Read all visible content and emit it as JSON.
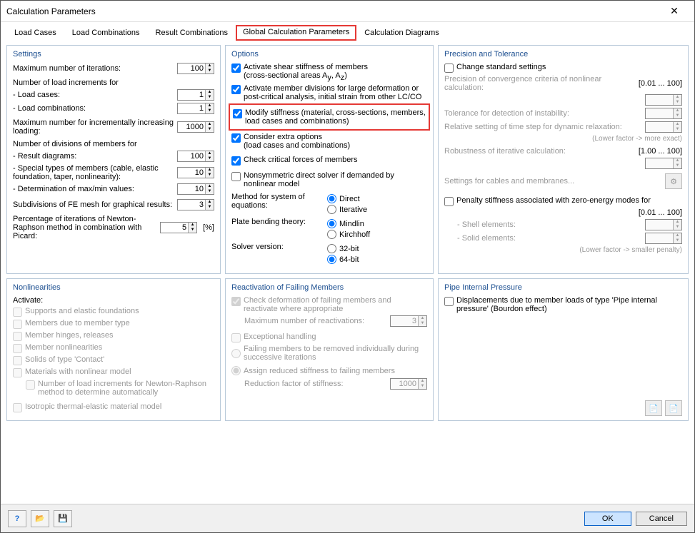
{
  "window": {
    "title": "Calculation Parameters"
  },
  "tabs": {
    "load_cases": "Load Cases",
    "load_comb": "Load Combinations",
    "result_comb": "Result Combinations",
    "global": "Global Calculation Parameters",
    "diagrams": "Calculation Diagrams"
  },
  "settings": {
    "title": "Settings",
    "max_iter_lbl": "Maximum number of iterations:",
    "max_iter": "100",
    "incr_hdr": "Number of load increments for",
    "lc_lbl": "- Load cases:",
    "lc": "1",
    "lco_lbl": "- Load combinations:",
    "lco": "1",
    "max_incr_lbl": "Maximum number for incrementally increasing loading:",
    "max_incr": "1000",
    "div_hdr": "Number of divisions of members for",
    "res_lbl": "- Result diagrams:",
    "res": "100",
    "spec_lbl": "- Special types of members (cable, elastic foundation, taper, nonlinearity):",
    "spec": "10",
    "det_lbl": "- Determination of max/min values:",
    "det": "10",
    "sub_lbl": "Subdivisions of FE mesh for graphical results:",
    "sub": "3",
    "nr_lbl": "Percentage of iterations of Newton-Raphson method in combination with Picard:",
    "nr": "5",
    "pct": "[%]"
  },
  "options": {
    "title": "Options",
    "shear": "Activate shear stiffness of members",
    "shear_sub": "(cross-sectional areas A",
    "shear_sub2": ", A",
    "shear_sub3": ")",
    "divis": "Activate member divisions for large deformation or post-critical analysis, initial strain from other LC/CO",
    "modify": "Modify stiffness (material, cross-sections, members, load cases and combinations)",
    "extra": "Consider extra options",
    "extra_sub": "(load cases and combinations)",
    "critical": "Check critical forces of members",
    "nonsym": "Nonsymmetric direct solver if demanded by nonlinear model",
    "method_lbl": "Method for system of equations:",
    "direct": "Direct",
    "iterative": "Iterative",
    "plate_lbl": "Plate bending theory:",
    "mindlin": "Mindlin",
    "kirch": "Kirchhoff",
    "solver_lbl": "Solver version:",
    "b32": "32-bit",
    "b64": "64-bit"
  },
  "precision": {
    "title": "Precision and Tolerance",
    "change": "Change standard settings",
    "conv_lbl": "Precision of convergence criteria of nonlinear calculation:",
    "conv_range": "[0.01 ... 100]",
    "tol_lbl": "Tolerance for detection of instability:",
    "rel_lbl": "Relative setting of time step for dynamic relaxation:",
    "note1": "(Lower factor -> more exact)",
    "rob_lbl": "Robustness of iterative calculation:",
    "rob_range": "[1.00 ... 100]",
    "cables": "Settings for cables and membranes...",
    "penalty": "Penalty stiffness associated with zero-energy modes for",
    "pen_range": "[0.01 ... 100]",
    "shell_lbl": "- Shell elements:",
    "solid_lbl": "- Solid elements:",
    "note2": "(Lower factor -> smaller penalty)"
  },
  "nonlin": {
    "title": "Nonlinearities",
    "activate": "Activate:",
    "supports": "Supports and elastic foundations",
    "members": "Members due to member type",
    "hinges": "Member hinges, releases",
    "mnon": "Member nonlinearities",
    "solids": "Solids of type 'Contact'",
    "mat": "Materials with nonlinear model",
    "nr": "Number of load increments for Newton-Raphson method to determine automatically",
    "iso": "Isotropic thermal-elastic material model"
  },
  "react": {
    "title": "Reactivation of Failing Members",
    "check": "Check deformation of failing members and reactivate where appropriate",
    "max_lbl": "Maximum number of reactivations:",
    "max": "3",
    "exc": "Exceptional handling",
    "fail": "Failing members to be removed individually during successive iterations",
    "assign": "Assign reduced stiffness to failing members",
    "red_lbl": "Reduction factor of stiffness:",
    "red": "1000"
  },
  "pipe": {
    "title": "Pipe Internal Pressure",
    "disp": "Displacements due to member loads of type 'Pipe internal pressure' (Bourdon effect)"
  },
  "footer": {
    "ok": "OK",
    "cancel": "Cancel"
  }
}
